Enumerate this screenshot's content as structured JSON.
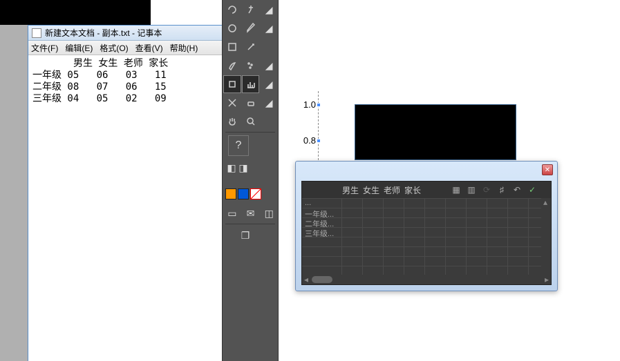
{
  "notepad": {
    "title": "新建文本文档 - 副本.txt - 记事本",
    "menu": [
      "文件(F)",
      "编辑(E)",
      "格式(O)",
      "查看(V)",
      "帮助(H)"
    ],
    "headers": [
      "男生",
      "女生",
      "老师",
      "家长"
    ],
    "rows": [
      {
        "label": "一年级",
        "cells": [
          "05",
          "06",
          "03",
          "11"
        ]
      },
      {
        "label": "二年级",
        "cells": [
          "08",
          "07",
          "06",
          "15"
        ]
      },
      {
        "label": "三年级",
        "cells": [
          "04",
          "05",
          "02",
          "09"
        ]
      }
    ]
  },
  "axis": {
    "tick_upper": "1.0",
    "tick_lower": "0.8"
  },
  "panel": {
    "columns": [
      "男生",
      "女生",
      "老师",
      "家长"
    ],
    "rows": [
      "一年级...",
      "二年级...",
      "三年级..."
    ],
    "blank_row": "...",
    "tools": {
      "undo": "↶",
      "confirm": "✓",
      "crop": "♯",
      "cycle": "⟳",
      "t1": "▦",
      "t2": "▥"
    }
  },
  "toolbox": {
    "help": "?"
  },
  "chart_data": {
    "type": "table",
    "columns": [
      "男生",
      "女生",
      "老师",
      "家长"
    ],
    "rows": [
      "一年级",
      "二年级",
      "三年级"
    ],
    "values": [
      [
        5,
        6,
        3,
        11
      ],
      [
        8,
        7,
        6,
        15
      ],
      [
        4,
        5,
        2,
        9
      ]
    ],
    "y_visible_ticks": [
      1.0,
      0.8
    ]
  }
}
